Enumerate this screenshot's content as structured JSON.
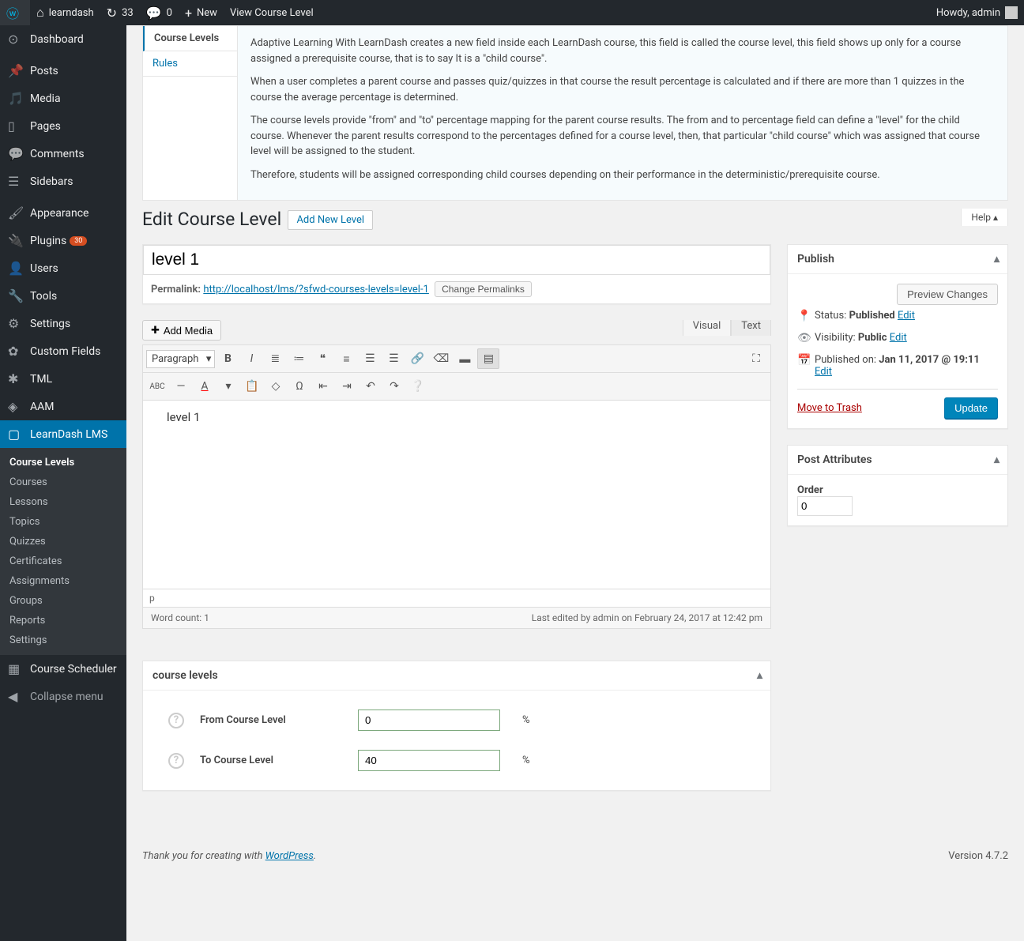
{
  "adminbar": {
    "site_name": "learndash",
    "updates_count": "33",
    "comments_count": "0",
    "new_label": "New",
    "view_label": "View Course Level",
    "howdy": "Howdy, admin"
  },
  "menu": {
    "dashboard": "Dashboard",
    "posts": "Posts",
    "media": "Media",
    "pages": "Pages",
    "comments": "Comments",
    "sidebars": "Sidebars",
    "appearance": "Appearance",
    "plugins": "Plugins",
    "plugins_badge": "30",
    "users": "Users",
    "tools": "Tools",
    "settings": "Settings",
    "custom_fields": "Custom Fields",
    "tml": "TML",
    "aam": "AAM",
    "learndash": "LearnDash LMS",
    "sub": {
      "course_levels": "Course Levels",
      "courses": "Courses",
      "lessons": "Lessons",
      "topics": "Topics",
      "quizzes": "Quizzes",
      "certificates": "Certificates",
      "assignments": "Assignments",
      "groups": "Groups",
      "reports": "Reports",
      "settings": "Settings"
    },
    "course_scheduler": "Course Scheduler",
    "collapse": "Collapse menu"
  },
  "info": {
    "tab_levels": "Course Levels",
    "tab_rules": "Rules",
    "p1": "Adaptive Learning With LearnDash creates a new field inside each LearnDash course, this field is called the course level, this field shows up only for a course assigned a prerequisite course, that is to say It is a \"child course\".",
    "p2": "When a user completes a parent course and passes quiz/quizzes in that course the result percentage is calculated and if there are more than 1 quizzes in the course the average percentage is determined.",
    "p3": "The course levels provide \"from\" and \"to\" percentage mapping for the parent course results. The from and to percentage field can define a \"level\" for the child course. Whenever the parent results correspond to the percentages defined for a course level, then, that particular \"child course\" which was assigned that course level will be assigned to the student.",
    "p4": "Therefore, students will be assigned corresponding child courses depending on their performance in the deterministic/prerequisite course."
  },
  "help_label": "Help",
  "page": {
    "title": "Edit Course Level",
    "add_new": "Add New Level"
  },
  "post": {
    "title_value": "level 1",
    "permalink_label": "Permalink:",
    "permalink_url": "http://localhost/lms/?sfwd-courses-levels=level-1",
    "change_permalinks": "Change Permalinks",
    "add_media": "Add Media",
    "visual_tab": "Visual",
    "text_tab": "Text",
    "format_select": "Paragraph",
    "content": "level 1",
    "path": "p",
    "word_count": "Word count: 1",
    "last_edited": "Last edited by admin on February 24, 2017 at 12:42 pm"
  },
  "publish": {
    "heading": "Publish",
    "preview": "Preview Changes",
    "status_label": "Status:",
    "status_value": "Published",
    "visibility_label": "Visibility:",
    "visibility_value": "Public",
    "published_label": "Published on:",
    "published_value": "Jan 11, 2017 @ 19:11",
    "edit": "Edit",
    "trash": "Move to Trash",
    "update": "Update"
  },
  "attributes": {
    "heading": "Post Attributes",
    "order_label": "Order",
    "order_value": "0"
  },
  "levels": {
    "heading": "course levels",
    "from_label": "From Course Level",
    "from_value": "0",
    "to_label": "To Course Level",
    "to_value": "40",
    "pct": "%"
  },
  "footer": {
    "thanks": "Thank you for creating with ",
    "wp": "WordPress",
    "period": ".",
    "version": "Version 4.7.2"
  }
}
